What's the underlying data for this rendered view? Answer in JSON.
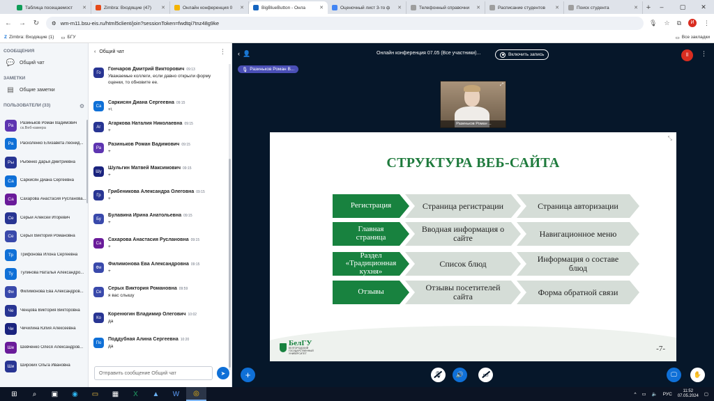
{
  "browser": {
    "tabs": [
      {
        "title": "Таблица посещаемост",
        "color": "#0f9d58"
      },
      {
        "title": "Zimbra: Входящие (47)",
        "color": "#e64a19"
      },
      {
        "title": "Онлайн конференция 0",
        "color": "#f4b400"
      },
      {
        "title": "BigBlueButton - Онла",
        "color": "#1565c0",
        "active": true
      },
      {
        "title": "Оценочный лист 3-то ф",
        "color": "#4285f4"
      },
      {
        "title": "Телефонный справочни",
        "color": "#9e9e9e"
      },
      {
        "title": "Расписание студентов",
        "color": "#9e9e9e"
      },
      {
        "title": "Поиск студента",
        "color": "#9e9e9e"
      }
    ],
    "url": "wm-m11.bsu-eis.ru/html5client/join?sessionToken=fwdtqi7tnz48g9ke",
    "profile_letter": "И",
    "bookmarks": [
      "Zimbra: Входящие (1)",
      "БГУ"
    ],
    "all_bookmarks": "Все закладки"
  },
  "sidebar": {
    "messages_header": "СООБЩЕНИЯ",
    "public_chat": "Общий чат",
    "notes_header": "ЗАМЕТКИ",
    "shared_notes": "Общие заметки",
    "users_header": "ПОЛЬЗОВАТЕЛИ (33)",
    "users": [
      {
        "initials": "Ра",
        "name": "Разиньков Роман Вадимович",
        "sub": "ск.Веб-камера",
        "color": "#5e35b1"
      },
      {
        "initials": "Ра",
        "name": "Расколенко Елизавета Леонид...",
        "color": "#0f70d7"
      },
      {
        "initials": "Ры",
        "name": "Рыбенко Дарья Дмитриевна",
        "color": "#283593"
      },
      {
        "initials": "Са",
        "name": "Саркисян Диана Сергеевна",
        "color": "#0f70d7"
      },
      {
        "initials": "Са",
        "name": "Сахарова Анастасия Русланова...",
        "color": "#6a1b9a"
      },
      {
        "initials": "Се",
        "name": "Серый Алексей Игоревич",
        "color": "#283593"
      },
      {
        "initials": "Се",
        "name": "Серых Виктория Романовна",
        "color": "#3949ab"
      },
      {
        "initials": "Тр",
        "name": "Трифонова Илона Сергеевна",
        "color": "#0f70d7"
      },
      {
        "initials": "Ту",
        "name": "Тулинова Наталья Александро...",
        "color": "#0f70d7"
      },
      {
        "initials": "Фи",
        "name": "Филимонова Ева Александров...",
        "color": "#3949ab"
      },
      {
        "initials": "Че",
        "name": "Ченцова Виктория Викторовна",
        "color": "#283593"
      },
      {
        "initials": "Чи",
        "name": "Чичилина Юлия Алексеевна",
        "color": "#1a237e"
      },
      {
        "initials": "Ше",
        "name": "Шевченко Олеся Александров...",
        "color": "#6a1b9a"
      },
      {
        "initials": "Ши",
        "name": "Широких Ольга Ивановна",
        "color": "#283593"
      }
    ]
  },
  "chat": {
    "back_label": "Общий чат",
    "input_placeholder": "Отправить сообщение Общий чат",
    "messages": [
      {
        "initials": "Го",
        "name": "Гончаров Дмитрий Викторович",
        "time": "09:13",
        "text": "Уважаемые коллеги, если давно открыли форму оценки, то обновите ее.",
        "color": "#283593"
      },
      {
        "initials": "Са",
        "name": "Саркисян Диана Сергеевна",
        "time": "09:15",
        "text": "+\\",
        "color": "#0f70d7"
      },
      {
        "initials": "Аг",
        "name": "Агаркова Наталия Николаевна",
        "time": "09:15",
        "text": "+",
        "color": "#283593"
      },
      {
        "initials": "Ра",
        "name": "Разиньков Роман Вадимович",
        "time": "09:15",
        "text": "+",
        "color": "#5e35b1"
      },
      {
        "initials": "Шу",
        "name": "Шульгин Матвей Максимович",
        "time": "09:15",
        "text": "+",
        "color": "#1a237e"
      },
      {
        "initials": "Гр",
        "name": "Грибеникова Александра Олеговна",
        "time": "09:15",
        "text": "+",
        "color": "#283593"
      },
      {
        "initials": "Бу",
        "name": "Булавина Ирина Анатольевна",
        "time": "09:15",
        "text": "+",
        "color": "#3949ab"
      },
      {
        "initials": "Са",
        "name": "Сахарова Анастасия Руслановна",
        "time": "09:15",
        "text": "+",
        "color": "#6a1b9a"
      },
      {
        "initials": "Фи",
        "name": "Филимонова Ева Александровна",
        "time": "09:15",
        "text": "+",
        "color": "#3949ab"
      },
      {
        "initials": "Се",
        "name": "Серых Виктория Романовна",
        "time": "09:59",
        "text": "я вас слышу",
        "color": "#3949ab"
      },
      {
        "initials": "Ко",
        "name": "Коренюгин Владимир Олегович",
        "time": "10:02",
        "text": "да",
        "color": "#283593"
      },
      {
        "initials": "По",
        "name": "Поддубная Алина Сергеевна",
        "time": "10:20",
        "text": "да",
        "color": "#0f70d7"
      }
    ]
  },
  "stage": {
    "meeting_title": "Онлайн конференция 07.05 (Все участники)...",
    "record_label": "Включить запись",
    "talker": "Разиньков Роман В...",
    "video_name": "Разиньков Роман ...",
    "connection_badge": "ll"
  },
  "slide": {
    "title": "СТРУКТУРА ВЕБ-САЙТА",
    "rows": [
      [
        "Регистрация",
        "Страница регистрации",
        "Страница авторизации"
      ],
      [
        "Главная страница",
        "Вводная информация о сайте",
        "Навигационное меню"
      ],
      [
        "Раздел «Традиционная кухня»",
        "Список блюд",
        "Информация о составе блюд"
      ],
      [
        "Отзывы",
        "Отзывы посетителей сайта",
        "Форма обратной связи"
      ]
    ],
    "logo_text": "БелГУ",
    "logo_sub": "БЕЛГОРОДСКИЙ ГОСУДАРСТВЕННЫЙ УНИВЕРСИТЕТ",
    "page_number": "-7-"
  },
  "taskbar": {
    "time": "11:52",
    "date": "07.05.2024",
    "lang": "РУС"
  }
}
